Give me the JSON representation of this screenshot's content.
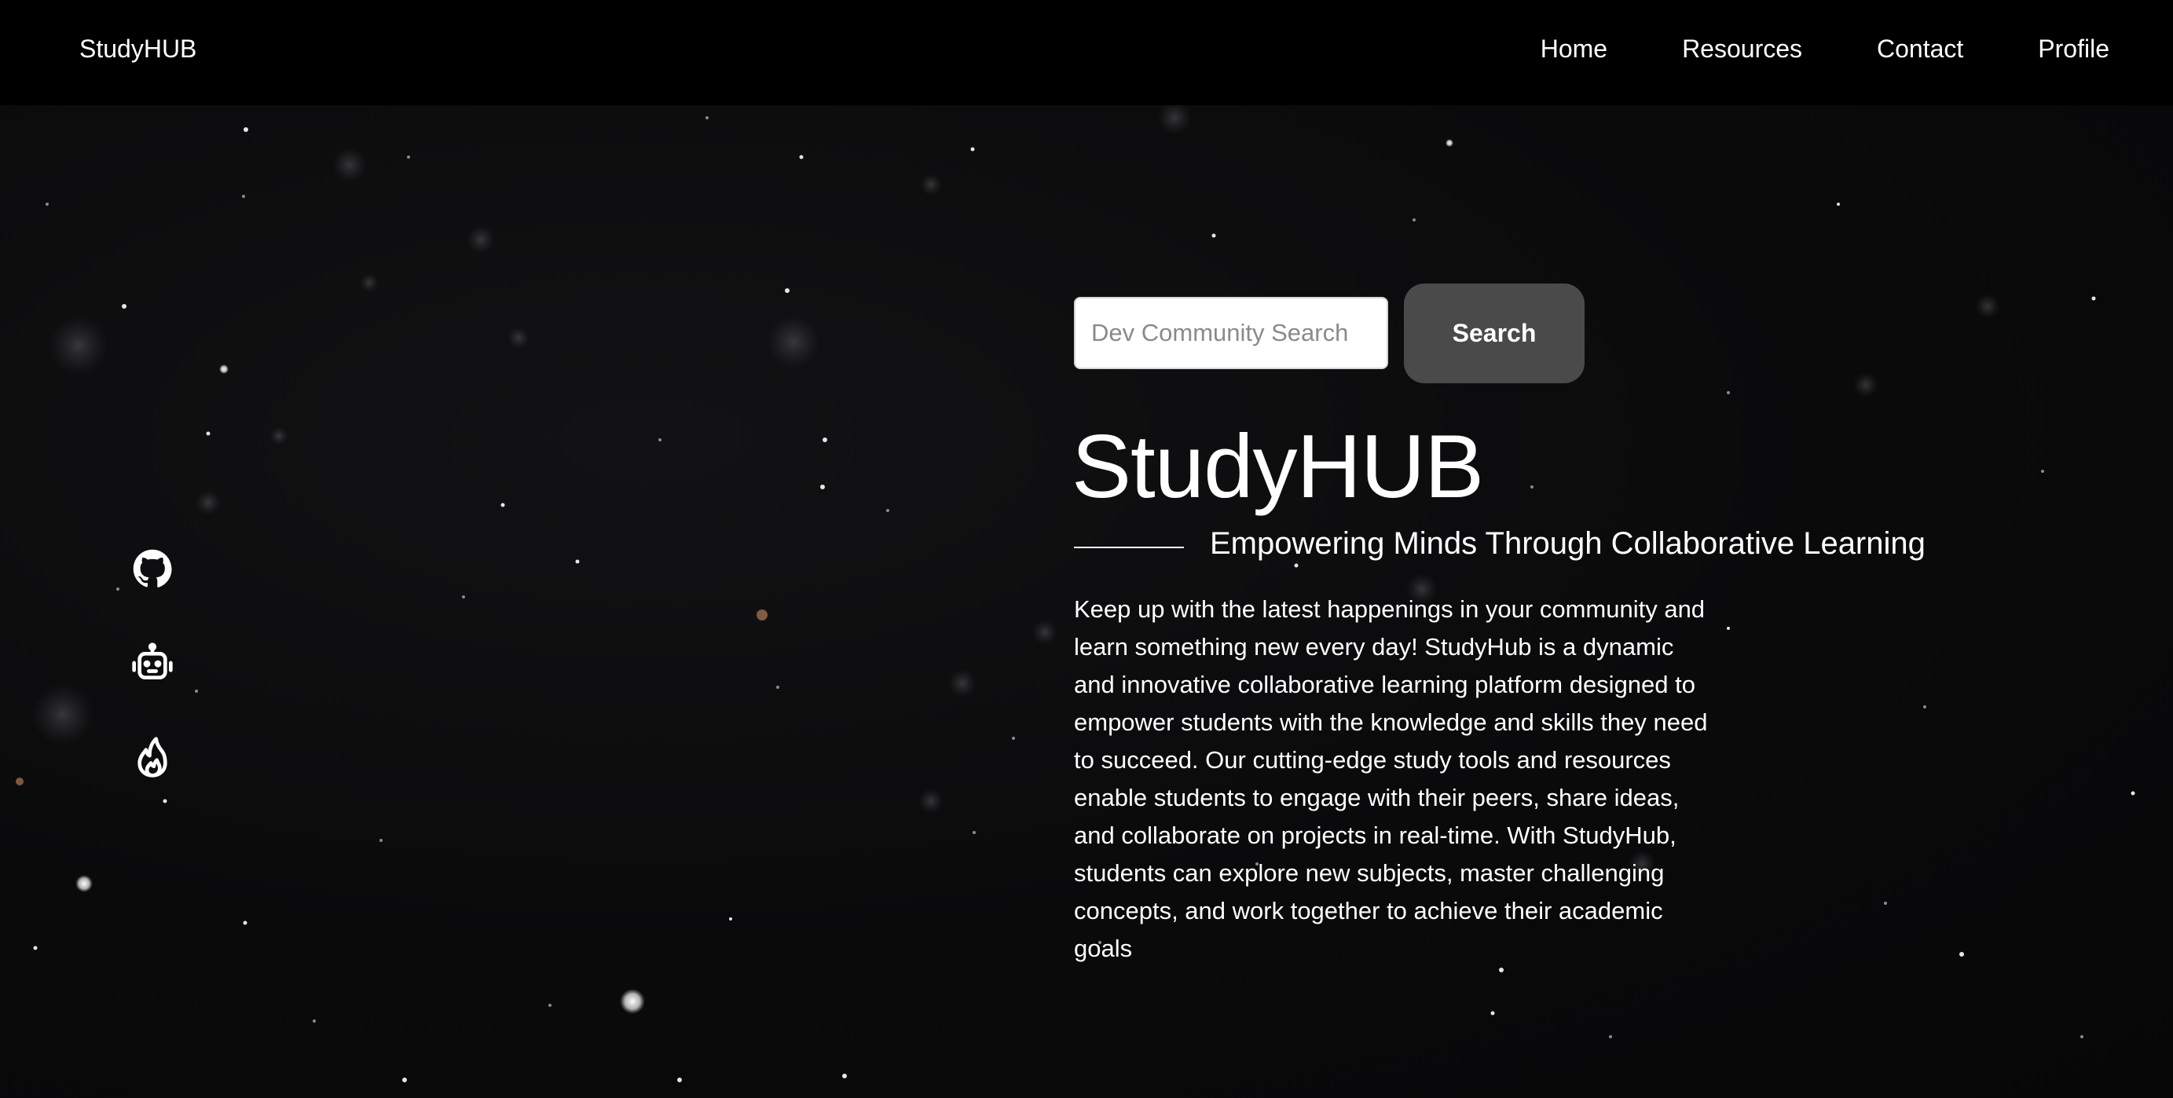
{
  "navbar": {
    "brand": "StudyHUB",
    "links": [
      {
        "label": "Home"
      },
      {
        "label": "Resources"
      },
      {
        "label": "Contact"
      },
      {
        "label": "Profile"
      }
    ]
  },
  "social": {
    "icons": [
      "github-icon",
      "robot-icon",
      "flame-icon"
    ]
  },
  "search": {
    "placeholder": "Dev Community Search",
    "value": "",
    "button_label": "Search"
  },
  "hero": {
    "title": "StudyHUB",
    "tagline": "Empowering Minds Through Collaborative Learning",
    "description": "Keep up with the latest happenings in your community and learn something new every day! StudyHub is a dynamic and innovative collaborative learning platform designed to empower students with the knowledge and skills they need to succeed. Our cutting-edge study tools and resources enable students to engage with their peers, share ideas, and collaborate on projects in real-time. With StudyHub, students can explore new subjects, master challenging concepts, and work together to achieve their academic goals"
  },
  "colors": {
    "navbar_bg": "#000000",
    "page_bg": "#0a0a0b",
    "search_button_bg": "#4a4a4a",
    "text": "#ffffff"
  }
}
